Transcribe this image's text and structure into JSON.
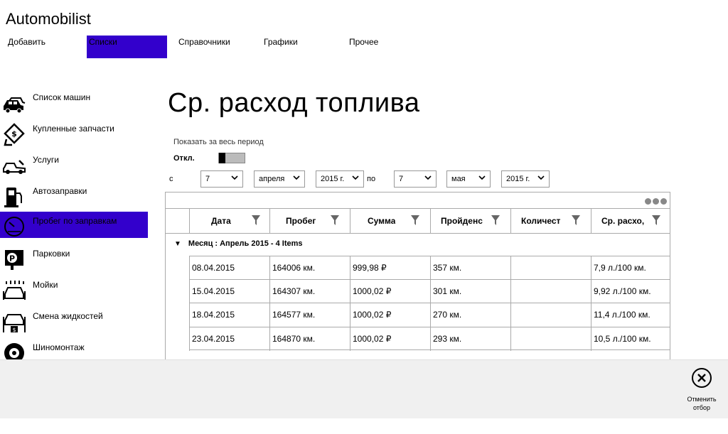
{
  "app": {
    "title": "Automobilist"
  },
  "topnav": {
    "tabs": [
      {
        "label": "Добавить"
      },
      {
        "label": "Списки"
      },
      {
        "label": "Справочники"
      },
      {
        "label": "Графики"
      },
      {
        "label": "Прочее"
      }
    ],
    "active_color": "#3300cc"
  },
  "sidebar": {
    "items": [
      {
        "label": "Список машин",
        "icon": "cars-icon"
      },
      {
        "label": "Купленные запчасти",
        "icon": "parts-receipt-icon"
      },
      {
        "label": "Услуги",
        "icon": "car-service-icon"
      },
      {
        "label": "Автозаправки",
        "icon": "fuel-pump-icon"
      },
      {
        "label": "Пробег по заправкам",
        "icon": "speedometer-icon"
      },
      {
        "label": "Парковки",
        "icon": "parking-icon"
      },
      {
        "label": "Мойки",
        "icon": "car-wash-icon"
      },
      {
        "label": "Смена жидкостей",
        "icon": "fluid-change-icon"
      },
      {
        "label": "Шиномонтаж",
        "icon": "tire-icon"
      }
    ]
  },
  "page": {
    "title": "Ср. расход топлива",
    "show_all_label": "Показать за весь период",
    "toggle_label": "Откл."
  },
  "date_filter": {
    "from_label": "с",
    "to_label": "по",
    "from_day": "7",
    "from_month": "апреля",
    "from_year": "2015 г.",
    "to_day": "7",
    "to_month": "мая",
    "to_year": "2015 г."
  },
  "grid": {
    "columns": [
      "Дата",
      "Пробег",
      "Сумма",
      "Пройденс",
      "Количест",
      "Ср. расхо,"
    ],
    "group_label": "Месяц : Апрель 2015 - 4 Items",
    "rows": [
      [
        "08.04.2015",
        "164006 км.",
        "999,98 ₽",
        "357 км.",
        "",
        "7,9 л./100 км."
      ],
      [
        "15.04.2015",
        "164307 км.",
        "1000,02 ₽",
        "301 км.",
        "",
        "9,92 л./100 км."
      ],
      [
        "18.04.2015",
        "164577 км.",
        "1000,02 ₽",
        "270 км.",
        "",
        "11,4 л./100 км."
      ],
      [
        "23.04.2015",
        "164870 км.",
        "1000,02 ₽",
        "293 км.",
        "",
        "10,5 л./100 км."
      ]
    ]
  },
  "bottombar": {
    "clear_filter_label": "Отменить отбор"
  }
}
